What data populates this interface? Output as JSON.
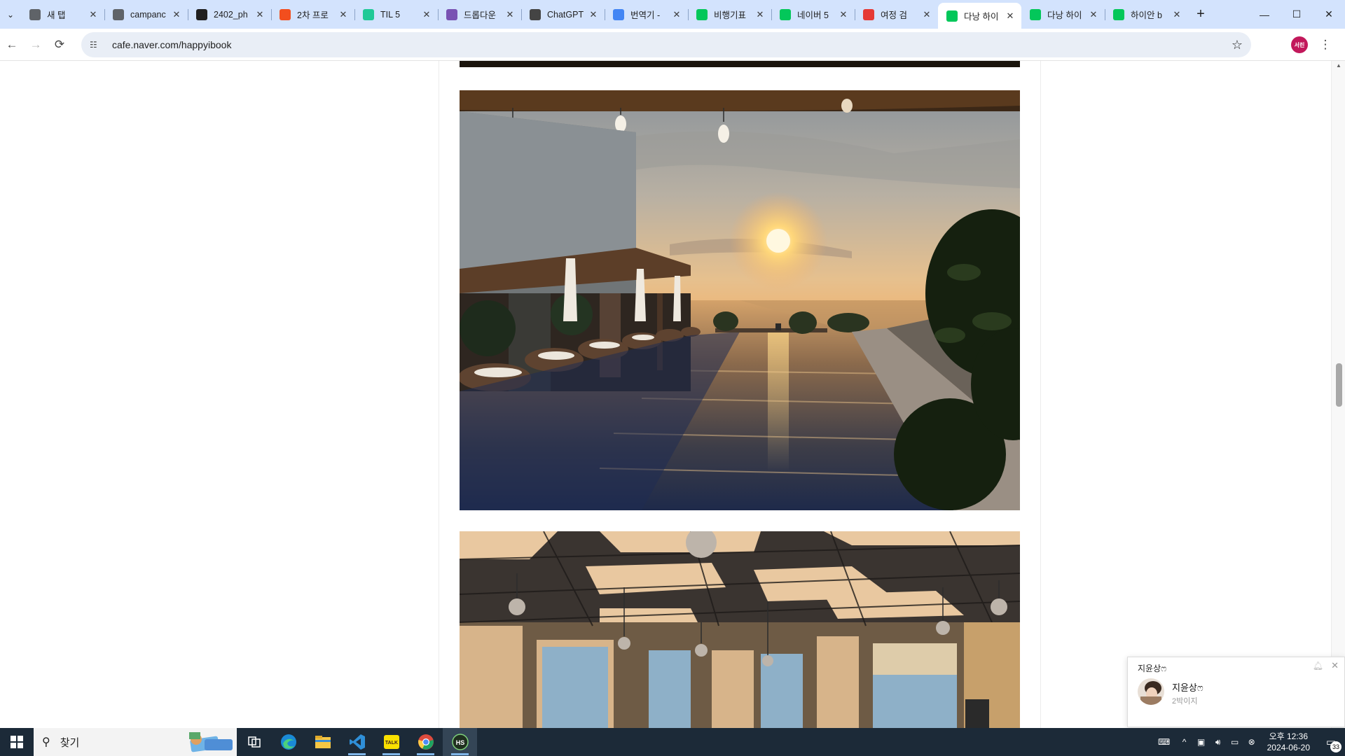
{
  "browser": {
    "tabs": [
      {
        "title": "새 탭",
        "icon": "chrome-icon",
        "color": "#5f6368"
      },
      {
        "title": "campanc",
        "icon": "globe-icon",
        "color": "#5f6368"
      },
      {
        "title": "2402_ph",
        "icon": "github-icon",
        "color": "#1f1f1f"
      },
      {
        "title": "2차 프로",
        "icon": "figma-icon",
        "color": "#f24e1e"
      },
      {
        "title": "TIL 5",
        "icon": "velog-icon",
        "color": "#20c997"
      },
      {
        "title": "드롭다운",
        "icon": "bootstrap-icon",
        "color": "#7952b3"
      },
      {
        "title": "ChatGPT",
        "icon": "chatgpt-icon",
        "color": "#444444"
      },
      {
        "title": "번역기 -",
        "icon": "google-icon",
        "color": "#4285f4"
      },
      {
        "title": "비행기표",
        "icon": "naver-icon",
        "color": "#03c75a"
      },
      {
        "title": "네이버 5",
        "icon": "naver-flight-icon",
        "color": "#03c75a"
      },
      {
        "title": "여정 검",
        "icon": "travel-icon",
        "color": "#e53935"
      },
      {
        "title": "다낭 하이",
        "icon": "naver-cafe-icon",
        "color": "#03c75a",
        "active": true
      },
      {
        "title": "다낭 하이",
        "icon": "naver-icon",
        "color": "#03c75a"
      },
      {
        "title": "하이안 b",
        "icon": "naver-cafe-icon",
        "color": "#03c75a"
      }
    ],
    "url": "cafe.naver.com/happyibook",
    "profile_initials": "서린"
  },
  "chat": {
    "header": "지윤상ෆ",
    "name": "지윤상ෆ",
    "subtitle": "2박이지"
  },
  "taskbar": {
    "search_label": "찾기",
    "apps": [
      "task-view-icon",
      "edge-icon",
      "file-explorer-icon",
      "vscode-icon",
      "kakaotalk-icon",
      "chrome-icon",
      "hs-app-icon"
    ],
    "clock_time": "오후 12:36",
    "clock_date": "2024-06-20",
    "notification_count": "33"
  }
}
